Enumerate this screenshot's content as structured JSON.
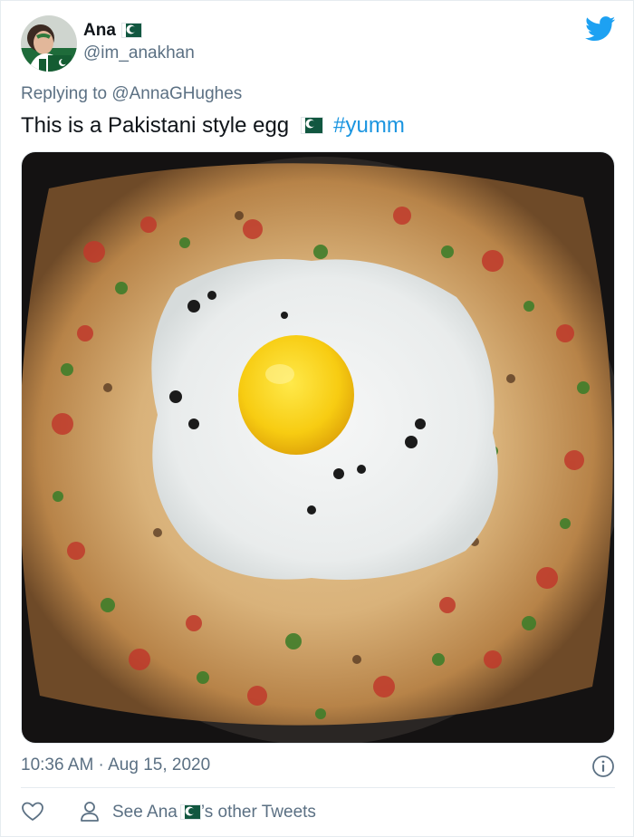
{
  "tweet": {
    "author_name": "Ana",
    "author_handle": "@im_anakhan",
    "replying_prefix": "Replying to",
    "replying_to": "@AnnaGHughes",
    "text": "This is a Pakistani style egg",
    "hashtag": "#yumm",
    "timestamp": "10:36 AM · Aug 15, 2020"
  },
  "footer": {
    "see_prefix": "See Ana",
    "see_suffix": "’s other Tweets"
  },
  "icons": {
    "brand": "twitter-bird-icon",
    "flag": "pakistan-flag-icon",
    "info": "info-icon",
    "like": "heart-icon",
    "profile": "person-icon"
  },
  "colors": {
    "link": "#1b95e0",
    "secondary_text": "#5b7083",
    "twitter_blue": "#1da1f2",
    "flag_green": "#115740"
  }
}
